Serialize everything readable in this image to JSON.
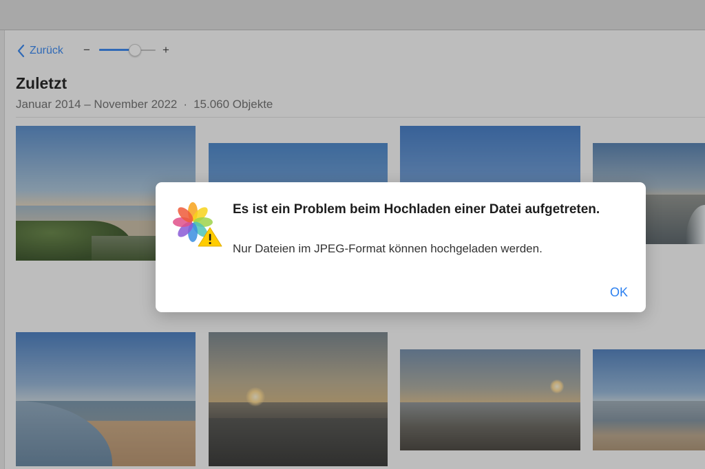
{
  "toolbar": {
    "back_label": "Zurück",
    "zoom_minus": "−",
    "zoom_plus": "+",
    "zoom_level": 0.63
  },
  "album": {
    "title": "Zuletzt",
    "date_range": "Januar 2014 – November 2022",
    "separator": "·",
    "item_count": "15.060 Objekte"
  },
  "dialog": {
    "icon": "photos-app-warning-icon",
    "title": "Es ist ein Problem beim Hochladen einer Datei aufgetreten.",
    "message": "Nur Dateien im JPEG-Format können hochgeladen werden.",
    "ok_label": "OK"
  },
  "colors": {
    "accent": "#2a7ff0",
    "warning": "#ffcc00"
  }
}
